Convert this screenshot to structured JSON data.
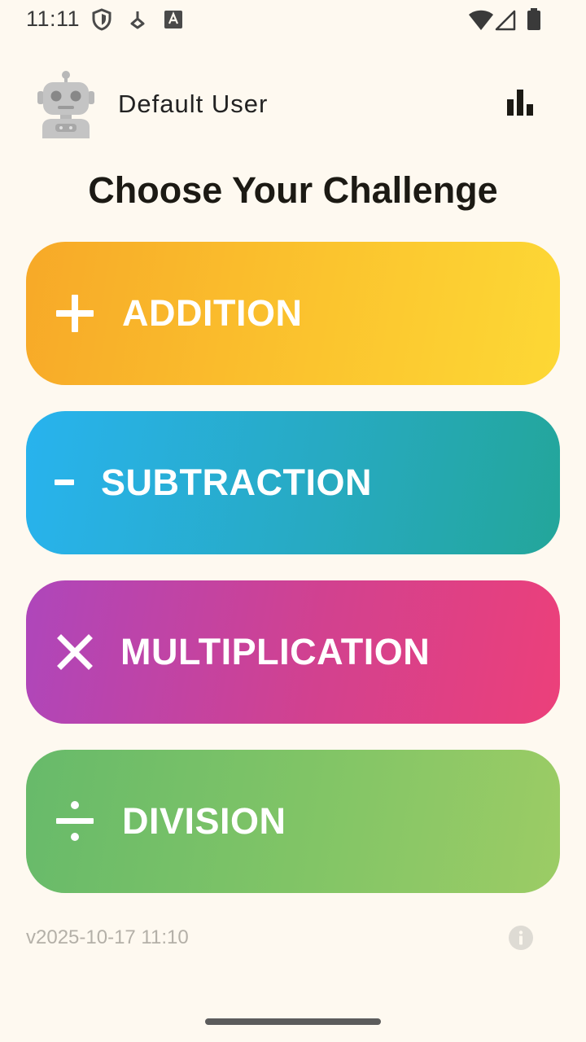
{
  "status_bar": {
    "time": "11:11",
    "icons": [
      "shield-icon",
      "download-icon",
      "font-icon",
      "wifi-icon",
      "signal-icon",
      "battery-icon"
    ]
  },
  "header": {
    "user_name": "Default User",
    "avatar_icon": "robot-icon",
    "stats_icon": "bar-chart-icon"
  },
  "title": "Choose Your Challenge",
  "challenges": [
    {
      "label": "ADDITION",
      "icon": "plus-icon",
      "colors": [
        "#F7A928",
        "#FDD835"
      ]
    },
    {
      "label": "SUBTRACTION",
      "icon": "minus-icon",
      "colors": [
        "#28B3EE",
        "#23A69A"
      ]
    },
    {
      "label": "MULTIPLICATION",
      "icon": "multiply-icon",
      "colors": [
        "#AE46BB",
        "#EC407A"
      ]
    },
    {
      "label": "DIVISION",
      "icon": "divide-icon",
      "colors": [
        "#67BA6A",
        "#9CCC65"
      ]
    }
  ],
  "footer": {
    "version": "v2025-10-17 11:10",
    "info_icon": "info-icon"
  },
  "colors": {
    "background": "#FEF9F0",
    "text": "#1C1A14"
  }
}
